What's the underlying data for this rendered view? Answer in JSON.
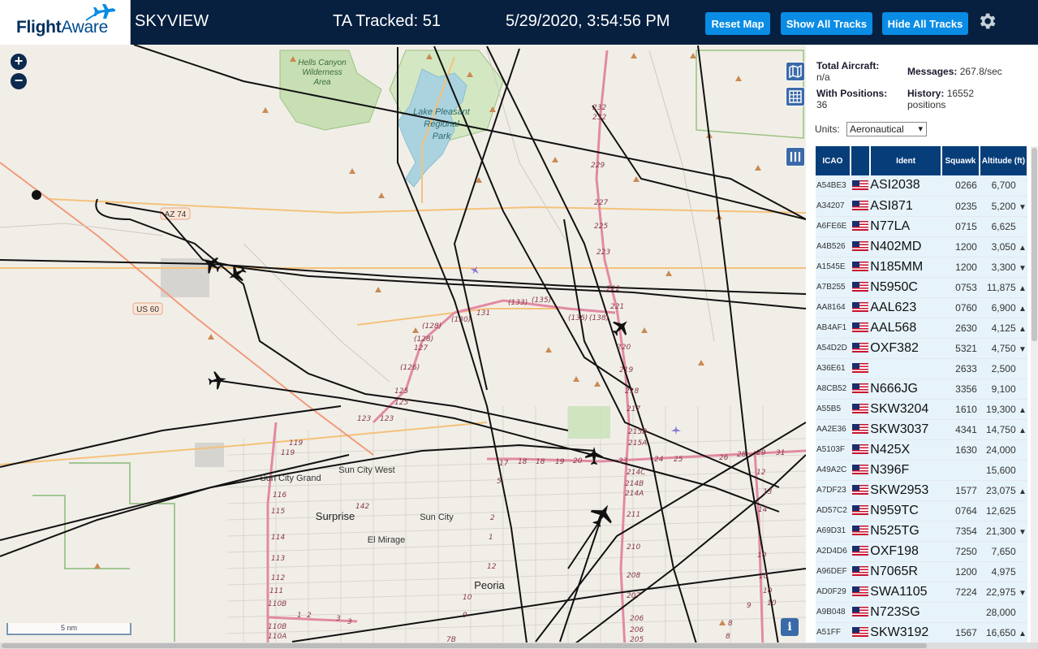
{
  "header": {
    "logo_flight": "Flight",
    "logo_aware": "Aware",
    "title": "SKYVIEW",
    "tracked": "TA Tracked: 51",
    "datetime": "5/29/2020, 3:54:56 PM",
    "reset_label": "Reset Map",
    "show_label": "Show All Tracks",
    "hide_label": "Hide All Tracks"
  },
  "map": {
    "zoom_in": "+",
    "zoom_out": "−",
    "scale_label": "5 nm",
    "info_label": "i",
    "labels": {
      "hells_canyon": "Hells Canyon",
      "wilderness": "Wilderness",
      "area": "Area",
      "lake_pleasant": "Lake Pleasant",
      "regional": "Regional",
      "park": "Park",
      "az74": "AZ 74",
      "us60": "US 60",
      "sun_city_grand": "Sun City Grand",
      "sun_city_west": "Sun City West",
      "surprise": "Surprise",
      "sun_city": "Sun City",
      "el_mirage": "El Mirage",
      "peoria": "Peoria"
    }
  },
  "stats": {
    "total_label": "Total Aircraft:",
    "total_value": "n/a",
    "messages_label": "Messages:",
    "messages_value": "267.8/sec",
    "positions_label": "With Positions:",
    "positions_value": "36",
    "history_label": "History:",
    "history_value": "16552",
    "history_unit": "positions",
    "units_label": "Units:",
    "units_value": "Aeronautical"
  },
  "table": {
    "headers": [
      "ICAO",
      "",
      "Ident",
      "Squawk",
      "Altitude (ft)"
    ],
    "rows": [
      {
        "icao": "A54BE3",
        "ident": "ASI2038",
        "squawk": "0266",
        "alt": "6,700",
        "trend": ""
      },
      {
        "icao": "A34207",
        "ident": "ASI871",
        "squawk": "0235",
        "alt": "5,200",
        "trend": "▼"
      },
      {
        "icao": "A6FE6E",
        "ident": "N77LA",
        "squawk": "0715",
        "alt": "6,625",
        "trend": ""
      },
      {
        "icao": "A4B526",
        "ident": "N402MD",
        "squawk": "1200",
        "alt": "3,050",
        "trend": "▲"
      },
      {
        "icao": "A1545E",
        "ident": "N185MM",
        "squawk": "1200",
        "alt": "3,300",
        "trend": "▼"
      },
      {
        "icao": "A7B255",
        "ident": "N5950C",
        "squawk": "0753",
        "alt": "11,875",
        "trend": "▲"
      },
      {
        "icao": "AA8164",
        "ident": "AAL623",
        "squawk": "0760",
        "alt": "6,900",
        "trend": "▲"
      },
      {
        "icao": "AB4AF1",
        "ident": "AAL568",
        "squawk": "2630",
        "alt": "4,125",
        "trend": "▲"
      },
      {
        "icao": "A54D2D",
        "ident": "OXF382",
        "squawk": "5321",
        "alt": "4,750",
        "trend": "▼"
      },
      {
        "icao": "A36E61",
        "ident": "",
        "squawk": "2633",
        "alt": "2,500",
        "trend": ""
      },
      {
        "icao": "A8CB52",
        "ident": "N666JG",
        "squawk": "3356",
        "alt": "9,100",
        "trend": ""
      },
      {
        "icao": "A55B5",
        "ident": "SKW3204",
        "squawk": "1610",
        "alt": "19,300",
        "trend": "▲"
      },
      {
        "icao": "AA2E36",
        "ident": "SKW3037",
        "squawk": "4341",
        "alt": "14,750",
        "trend": "▲"
      },
      {
        "icao": "A5103F",
        "ident": "N425X",
        "squawk": "1630",
        "alt": "24,000",
        "trend": ""
      },
      {
        "icao": "A49A2C",
        "ident": "N396F",
        "squawk": "",
        "alt": "15,600",
        "trend": ""
      },
      {
        "icao": "A7DF23",
        "ident": "SKW2953",
        "squawk": "1577",
        "alt": "23,075",
        "trend": "▲"
      },
      {
        "icao": "AD57C2",
        "ident": "N959TC",
        "squawk": "0764",
        "alt": "12,625",
        "trend": ""
      },
      {
        "icao": "A69D31",
        "ident": "N525TG",
        "squawk": "7354",
        "alt": "21,300",
        "trend": "▼"
      },
      {
        "icao": "A2D4D6",
        "ident": "OXF198",
        "squawk": "7250",
        "alt": "7,650",
        "trend": ""
      },
      {
        "icao": "A96DEF",
        "ident": "N7065R",
        "squawk": "1200",
        "alt": "4,975",
        "trend": ""
      },
      {
        "icao": "AD0F29",
        "ident": "SWA1105",
        "squawk": "7224",
        "alt": "22,975",
        "trend": "▼"
      },
      {
        "icao": "A9B048",
        "ident": "N723SG",
        "squawk": "",
        "alt": "28,000",
        "trend": ""
      },
      {
        "icao": "A51FF",
        "ident": "SKW3192",
        "squawk": "1567",
        "alt": "16,650",
        "trend": "▲"
      }
    ]
  },
  "colors": {
    "header_bg": "#072040",
    "button_bg": "#0a8ce4",
    "table_header_bg": "#073e7a",
    "row_bg": "#e6f3fb"
  }
}
